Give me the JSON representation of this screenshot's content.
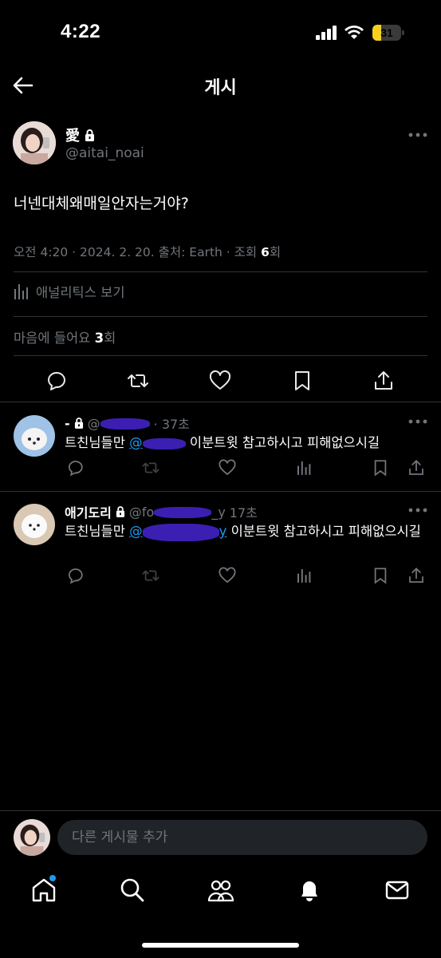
{
  "status_bar": {
    "time": "4:22",
    "battery": "31",
    "battery_level": 0.31
  },
  "header": {
    "title": "게시"
  },
  "post": {
    "author_name": "愛",
    "author_handle": "@aitai_noai",
    "text": "너넨대체왜매일안자는거야?",
    "meta": "오전 4:20 · 2024. 2. 20. 출처: Earth · 조회 ",
    "views": "6",
    "views_suffix": "회",
    "analytics_label": "애널리틱스 보기",
    "likes_prefix": "마음에 들어요 ",
    "likes_count": "3",
    "likes_suffix": "회"
  },
  "replies": [
    {
      "name": "-",
      "handle": "@",
      "time": "37초",
      "text_before": "트친님들만 ",
      "mention": "@",
      "text_after": " 이분트윗 참고하시고 피해없으시길"
    },
    {
      "name": "애기도리",
      "handle": "@fo",
      "handle_tail": "_y",
      "time": "17초",
      "text_before": "트친님들만 ",
      "mention": "@",
      "mention_tail": "y",
      "text_after": " 이분트윗 참고하시고 피해없으시길"
    }
  ],
  "compose": {
    "placeholder": "다른 게시물 추가"
  },
  "nav": [
    "home-icon",
    "search-icon",
    "communities-icon",
    "notifications-icon",
    "messages-icon"
  ],
  "colors": {
    "accent": "#1d9bf0",
    "background": "#000000",
    "muted": "#71767b",
    "battery": "#f6d01f"
  }
}
